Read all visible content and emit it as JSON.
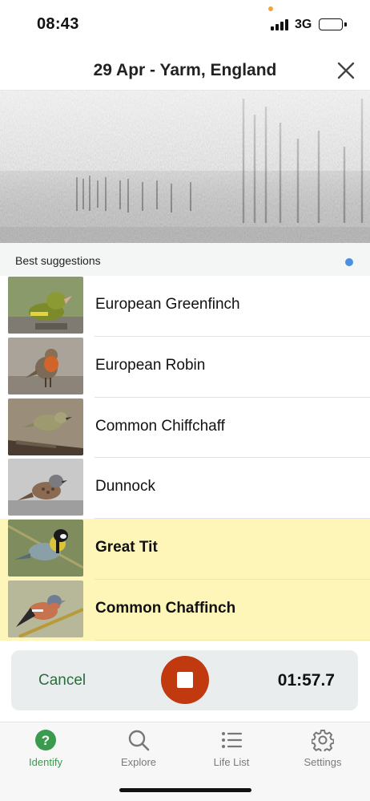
{
  "status_bar": {
    "time": "08:43",
    "network": "3G",
    "signal_bars": 4,
    "battery_level": 1.0
  },
  "header": {
    "title": "29 Apr - Yarm, England",
    "close_icon": "close-icon"
  },
  "suggestions": {
    "section_label": "Best suggestions",
    "indicator_color": "#4a90e2",
    "items": [
      {
        "name": "European Greenfinch",
        "highlighted": false,
        "icon": "bird-photo"
      },
      {
        "name": "European Robin",
        "highlighted": false,
        "icon": "bird-photo"
      },
      {
        "name": "Common Chiffchaff",
        "highlighted": false,
        "icon": "bird-photo"
      },
      {
        "name": "Dunnock",
        "highlighted": false,
        "icon": "bird-photo"
      },
      {
        "name": "Great Tit",
        "highlighted": true,
        "icon": "bird-photo"
      },
      {
        "name": "Common Chaffinch",
        "highlighted": true,
        "icon": "bird-photo"
      }
    ]
  },
  "recording": {
    "cancel_label": "Cancel",
    "timer": "01:57.7",
    "stop_color": "#c0390f"
  },
  "tabs": [
    {
      "label": "Identify",
      "icon": "question-circle-icon",
      "active": true
    },
    {
      "label": "Explore",
      "icon": "search-icon",
      "active": false
    },
    {
      "label": "Life List",
      "icon": "list-icon",
      "active": false
    },
    {
      "label": "Settings",
      "icon": "gear-icon",
      "active": false
    }
  ],
  "colors": {
    "accent_green": "#3a9a4e",
    "highlight": "#fdf6b8",
    "stop_red": "#c0390f"
  }
}
